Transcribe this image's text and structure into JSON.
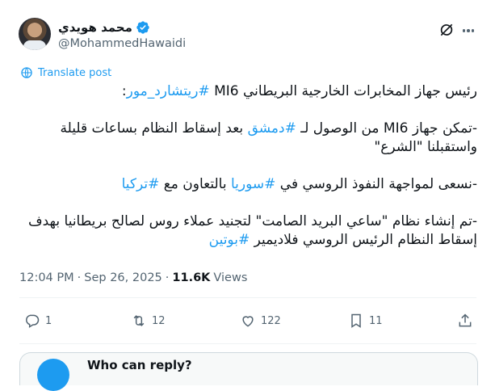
{
  "author": {
    "display_name": "محمد هويدي",
    "handle": "@MohammedHawaidi",
    "verified_icon": "verified-badge-icon"
  },
  "translate_label": "Translate post",
  "tweet": {
    "line1_before": "رئيس جهاز المخابرات الخارجية البريطاني MI6 ",
    "line1_tag": "#ريتشارد_مور",
    "line1_after": ":",
    "para2_before": "-تمكن جهاز MI6 من الوصول لـ ",
    "para2_tag": "#دمشق",
    "para2_after": " بعد إسقاط النظام بساعات قليلة واستقبلنا \"الشرع\"",
    "para3_before": "-نسعى لمواجهة النفوذ الروسي في ",
    "para3_tag1": "#سوريا",
    "para3_mid": " بالتعاون مع ",
    "para3_tag2": "#تركيا",
    "para4_text": "-تم إنشاء نظام \"ساعي البريد الصامت\" لتجنيد عملاء روس لصالح بريطانيا بهدف إسقاط النظام الرئيس الروسي فلاديمير ",
    "para4_tag": "#بوتين"
  },
  "meta": {
    "time": "12:04 PM",
    "separator": "·",
    "date": "Sep 26, 2025",
    "views_count": "11.6K",
    "views_label": "Views"
  },
  "actions": {
    "replies": "1",
    "reposts": "12",
    "likes": "122",
    "bookmarks": "11"
  },
  "reply_prompt": "Who can reply?"
}
